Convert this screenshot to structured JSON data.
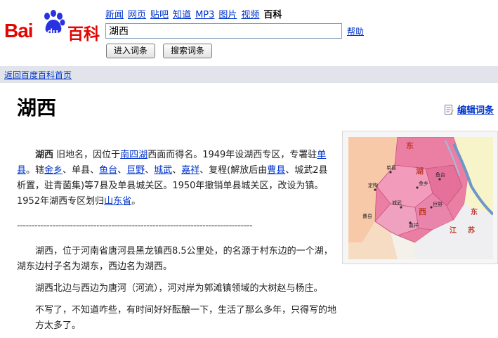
{
  "logo": {
    "bai": "Bai",
    "du": "du",
    "baike": "百科"
  },
  "nav": {
    "links": [
      "新闻",
      "网页",
      "贴吧",
      "知道",
      "MP3",
      "图片",
      "视频"
    ],
    "active": "百科"
  },
  "search": {
    "value": "湖西"
  },
  "help_label": "帮助",
  "buttons": {
    "enter": "进入词条",
    "search": "搜索词条"
  },
  "breadcrumb": "返回百度百科首页",
  "title": "湖西",
  "edit_label": "编辑词条",
  "map": {
    "labels": [
      "东",
      "湖",
      "西",
      "东",
      "江",
      "苏",
      "单县",
      "定陶",
      "城武",
      "鱼台",
      "巨野",
      "嘉祥",
      "金乡",
      "曹县"
    ]
  },
  "article": {
    "p1": {
      "term": "湖西",
      "t1": "旧地名，因位于",
      "l1": "南四湖",
      "t2": "西面而得名。1949年设湖西专区，专署驻",
      "l2": "单县",
      "t3": "。辖",
      "l3": "金乡",
      "t4": "、单县、",
      "l4": "鱼台",
      "t5": "、",
      "l5": "巨野",
      "t6": "、",
      "l6": "城武",
      "t7": "、",
      "l7": "嘉祥",
      "t8": "、复程(解放后由",
      "l8": "曹县",
      "t9": "、城武2县析置，驻青菌集)等7县及单县城关区。1950年撤销单县城关区，改设为镇。1952年湖西专区划归",
      "l9": "山东省",
      "t10": "。"
    },
    "separator": "--------------------------------------------------------------------------------",
    "p2": "湖西，位于河南省唐河县黑龙镇西8.5公里处，的名源于村东边的一个湖，湖东边村子名为湖东，西边名为湖西。",
    "p3": "湖西北边与西边为唐河（河流），河对岸为郭滩镇领域的大树赵与杨庄。",
    "p4": "不写了，不知道咋些，有时间好好酝酿一下，生活了那么多年，只得写的地方太多了。"
  }
}
